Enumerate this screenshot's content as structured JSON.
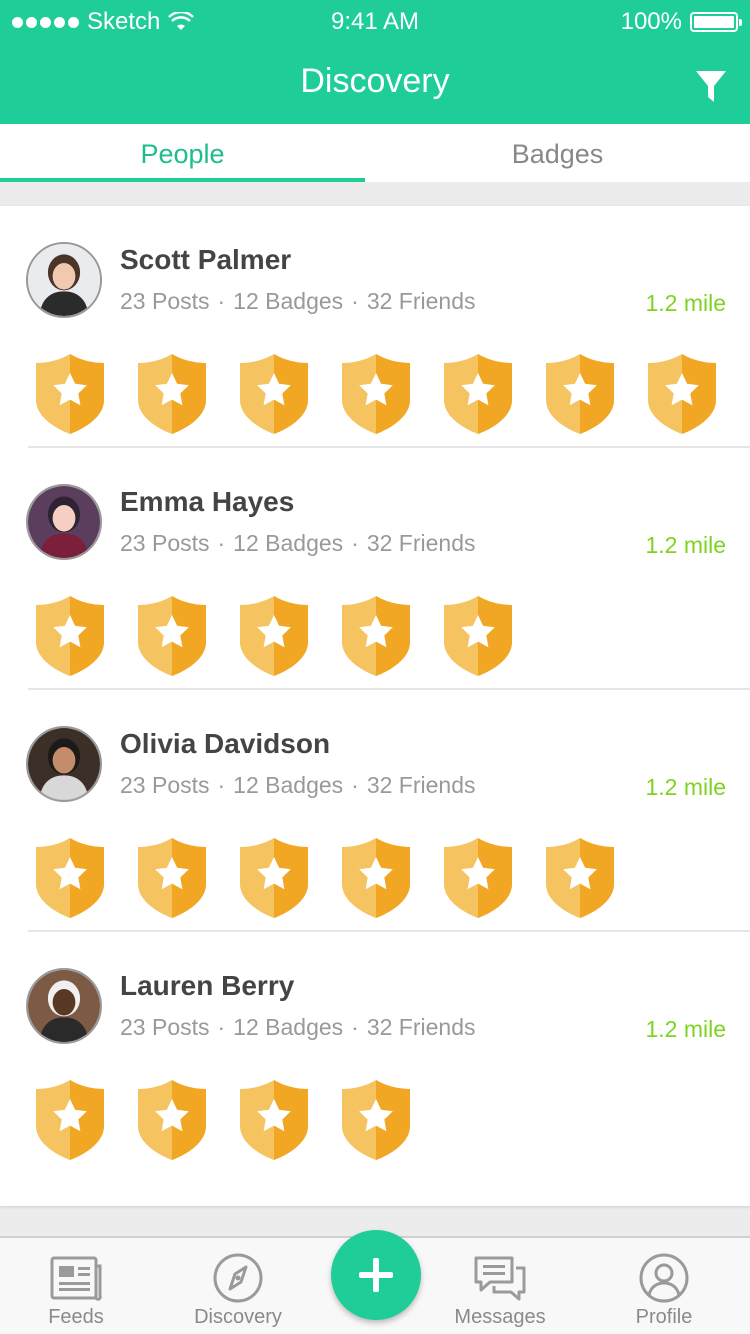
{
  "status_bar": {
    "carrier": "Sketch",
    "time": "9:41 AM",
    "battery": "100%",
    "battery_level": 1.0
  },
  "nav": {
    "title": "Discovery",
    "filter_icon": "filter-icon"
  },
  "tabs": [
    {
      "label": "People",
      "active": true
    },
    {
      "label": "Badges",
      "active": false
    }
  ],
  "people": [
    {
      "name": "Scott Palmer",
      "posts": "23 Posts",
      "badges": "12 Badges",
      "friends": "32 Friends",
      "distance": "1.2 mile",
      "badge_count": 7
    },
    {
      "name": "Emma Hayes",
      "posts": "23 Posts",
      "badges": "12 Badges",
      "friends": "32 Friends",
      "distance": "1.2 mile",
      "badge_count": 5
    },
    {
      "name": "Olivia Davidson",
      "posts": "23 Posts",
      "badges": "12 Badges",
      "friends": "32 Friends",
      "distance": "1.2 mile",
      "badge_count": 6
    },
    {
      "name": "Lauren Berry",
      "posts": "23 Posts",
      "badges": "12 Badges",
      "friends": "32 Friends",
      "distance": "1.2 mile",
      "badge_count": 4
    }
  ],
  "tab_bar": {
    "items": [
      {
        "label": "Feeds",
        "icon": "newspaper-icon"
      },
      {
        "label": "Discovery",
        "icon": "compass-icon"
      },
      {
        "label": "Messages",
        "icon": "chat-bubbles-icon"
      },
      {
        "label": "Profile",
        "icon": "user-circle-icon"
      }
    ],
    "fab_icon": "plus-icon"
  },
  "colors": {
    "brand": "#1ecd98",
    "distance": "#7ed321",
    "badge_light": "#f5c460",
    "badge_dark": "#f2a724"
  }
}
